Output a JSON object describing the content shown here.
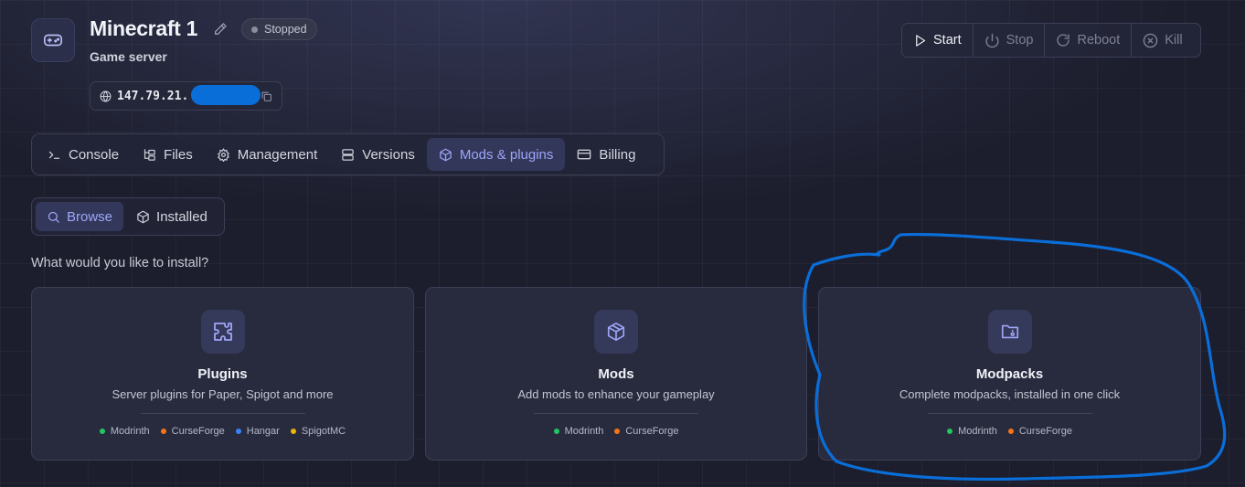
{
  "server": {
    "name": "Minecraft 1",
    "status": "Stopped",
    "type": "Game server",
    "address": "147.79.21.",
    "icon": "gamepad-icon"
  },
  "power": {
    "start": "Start",
    "stop": "Stop",
    "reboot": "Reboot",
    "kill": "Kill"
  },
  "tabs": [
    {
      "label": "Console",
      "icon": "terminal-icon"
    },
    {
      "label": "Files",
      "icon": "folder-tree-icon"
    },
    {
      "label": "Management",
      "icon": "gear-icon"
    },
    {
      "label": "Versions",
      "icon": "server-stack-icon"
    },
    {
      "label": "Mods & plugins",
      "icon": "package-icon",
      "active": true
    },
    {
      "label": "Billing",
      "icon": "credit-card-icon"
    }
  ],
  "subtabs": [
    {
      "label": "Browse",
      "icon": "search-icon",
      "active": true
    },
    {
      "label": "Installed",
      "icon": "package-icon"
    }
  ],
  "prompt": "What would you like to install?",
  "cards": [
    {
      "title": "Plugins",
      "description": "Server plugins for Paper, Spigot and more",
      "icon": "puzzle-icon",
      "sources": [
        {
          "name": "Modrinth",
          "color": "#22c55e"
        },
        {
          "name": "CurseForge",
          "color": "#f97316"
        },
        {
          "name": "Hangar",
          "color": "#3b82f6"
        },
        {
          "name": "SpigotMC",
          "color": "#eab308"
        }
      ]
    },
    {
      "title": "Mods",
      "description": "Add mods to enhance your gameplay",
      "icon": "box-icon",
      "sources": [
        {
          "name": "Modrinth",
          "color": "#22c55e"
        },
        {
          "name": "CurseForge",
          "color": "#f97316"
        }
      ]
    },
    {
      "title": "Modpacks",
      "description": "Complete modpacks, installed in one click",
      "icon": "folder-archive-icon",
      "sources": [
        {
          "name": "Modrinth",
          "color": "#22c55e"
        },
        {
          "name": "CurseForge",
          "color": "#f97316"
        }
      ]
    }
  ],
  "colors": {
    "accent": "#9ea5f8",
    "annotation": "#0a6ed9",
    "background": "#1c1e2d"
  }
}
